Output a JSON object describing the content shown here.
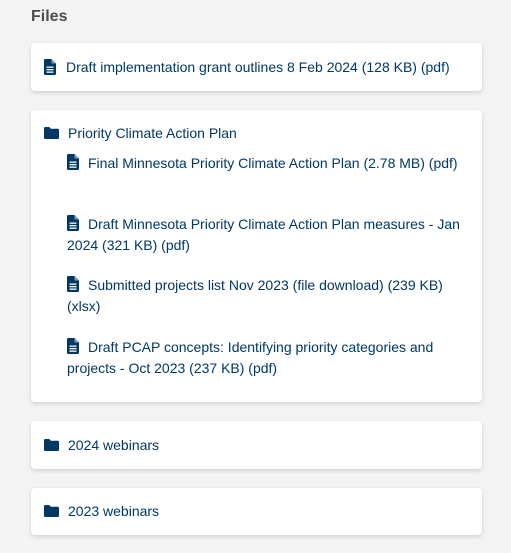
{
  "section": {
    "title": "Files"
  },
  "top_file": {
    "label": "Draft implementation grant outlines 8 Feb 2024 (128 KB) (pdf)",
    "icon": "file-icon"
  },
  "folders": [
    {
      "label": "Priority Climate Action Plan",
      "icon": "folder-icon",
      "expanded": true,
      "files": [
        {
          "label": "Final Minnesota Priority Climate Action Plan (2.78 MB) (pdf)",
          "icon": "file-icon"
        },
        {
          "label": "Draft Minnesota Priority Climate Action Plan measures - Jan 2024 (321 KB) (pdf)",
          "icon": "file-icon"
        },
        {
          "label": "Submitted projects list Nov 2023 (file download) (239 KB) (xlsx)",
          "icon": "file-icon"
        },
        {
          "label": "Draft PCAP concepts: Identifying priority categories and projects - Oct 2023 (237 KB) (pdf)",
          "icon": "file-icon"
        }
      ]
    },
    {
      "label": "2024 webinars",
      "icon": "folder-icon",
      "expanded": false
    },
    {
      "label": "2023 webinars",
      "icon": "folder-icon",
      "expanded": false
    }
  ],
  "colors": {
    "link": "#003865",
    "heading": "#4d4d4d",
    "background": "#f3f3f3",
    "card": "#ffffff"
  }
}
